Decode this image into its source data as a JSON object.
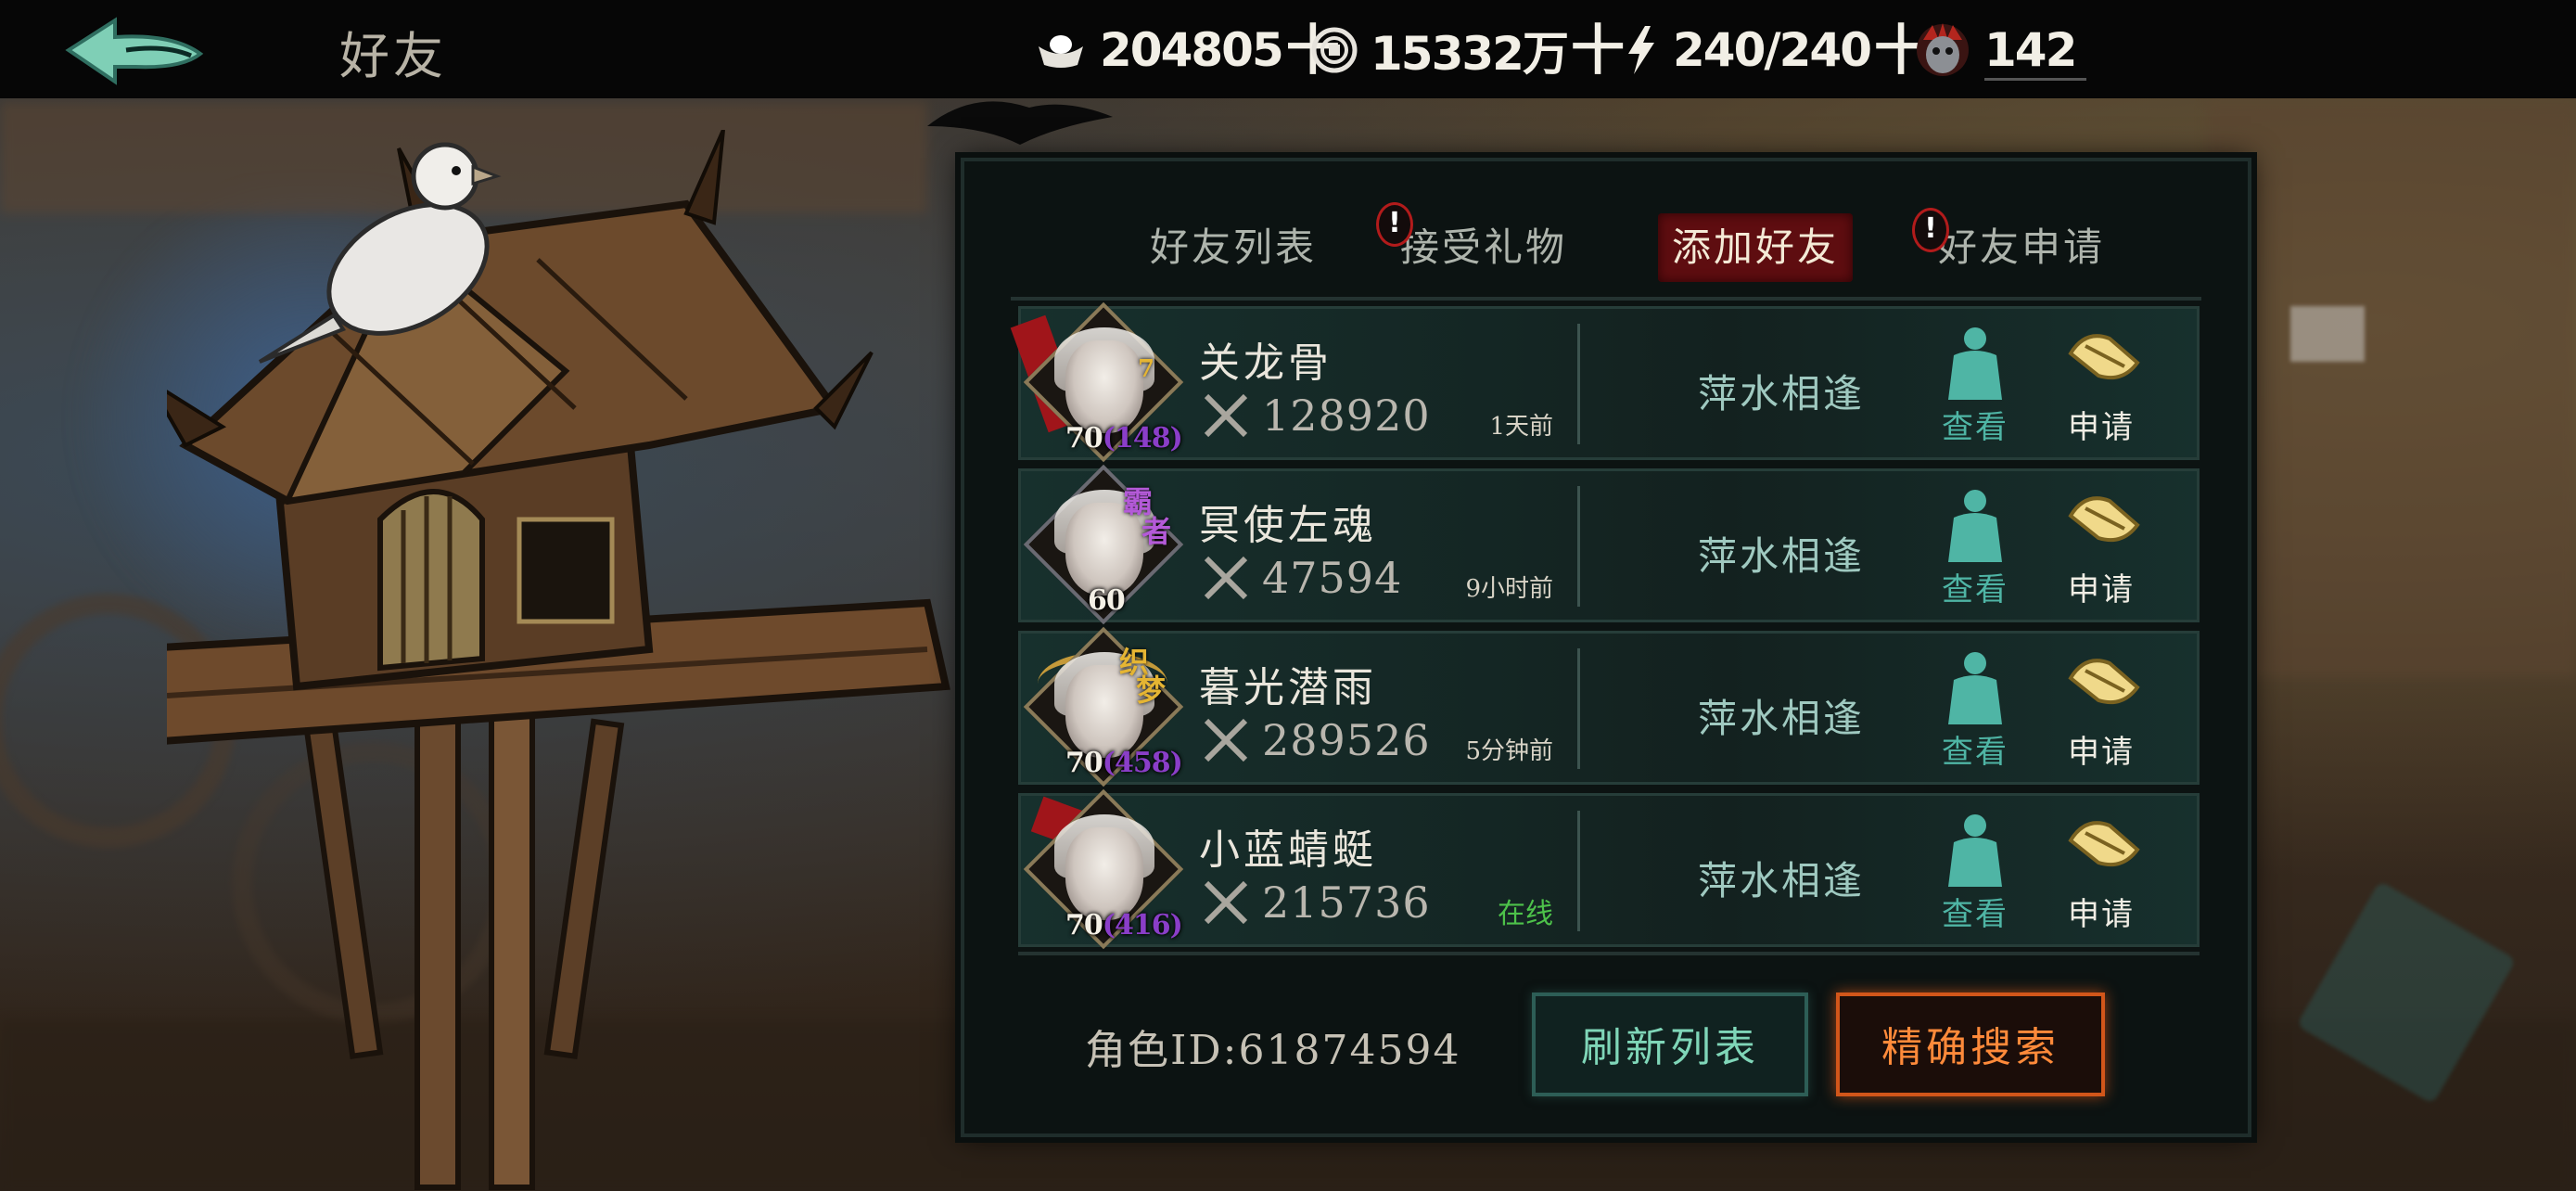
{
  "topbar": {
    "title": "好友",
    "resources": [
      {
        "icon": "silver-ingot-icon",
        "value": "204805",
        "plus": "十"
      },
      {
        "icon": "copper-coin-icon",
        "value": "15332万",
        "plus": "十"
      },
      {
        "icon": "lightning-icon",
        "value": "240/240",
        "plus": "十"
      },
      {
        "icon": "demon-mask-icon",
        "value": "142"
      }
    ]
  },
  "tabs": [
    {
      "label": "好友列表",
      "badge": false,
      "active": false
    },
    {
      "label": "接受礼物",
      "badge": true,
      "active": false
    },
    {
      "label": "添加好友",
      "badge": false,
      "active": true
    },
    {
      "label": "好友申请",
      "badge": true,
      "active": false
    }
  ],
  "badge_text": "!",
  "friends": [
    {
      "name": "关龙骨",
      "level": "70",
      "level_sub": "(148)",
      "power": "128920",
      "last_seen": "1天前",
      "online": false,
      "relation": "萍水相逢",
      "view_label": "查看",
      "apply_label": "申请",
      "avatar_tag": "",
      "avatar_tag2": ""
    },
    {
      "name": "冥使左魂",
      "level": "60",
      "level_sub": "",
      "power": "47594",
      "last_seen": "9小时前",
      "online": false,
      "relation": "萍水相逢",
      "view_label": "查看",
      "apply_label": "申请",
      "avatar_tag": "霸",
      "avatar_tag2": "者"
    },
    {
      "name": "暮光潜雨",
      "level": "70",
      "level_sub": "(458)",
      "power": "289526",
      "last_seen": "5分钟前",
      "online": false,
      "relation": "萍水相逢",
      "view_label": "查看",
      "apply_label": "申请",
      "avatar_tag": "织",
      "avatar_tag2": "梦"
    },
    {
      "name": "小蓝蜻蜓",
      "level": "70",
      "level_sub": "(416)",
      "power": "215736",
      "last_seen": "在线",
      "online": true,
      "relation": "萍水相逢",
      "view_label": "查看",
      "apply_label": "申请",
      "avatar_tag": "",
      "avatar_tag2": ""
    }
  ],
  "footer": {
    "role_id": "角色ID:61874594",
    "refresh_label": "刷新列表",
    "search_label": "精确搜索"
  },
  "colors": {
    "active_tab": "#5e0d10",
    "view_green": "#4fb5a5",
    "online_green": "#4dc24a",
    "level_purple": "#8a3ec8",
    "search_orange": "#ff8a3a",
    "refresh_teal": "#7fd6b8"
  }
}
